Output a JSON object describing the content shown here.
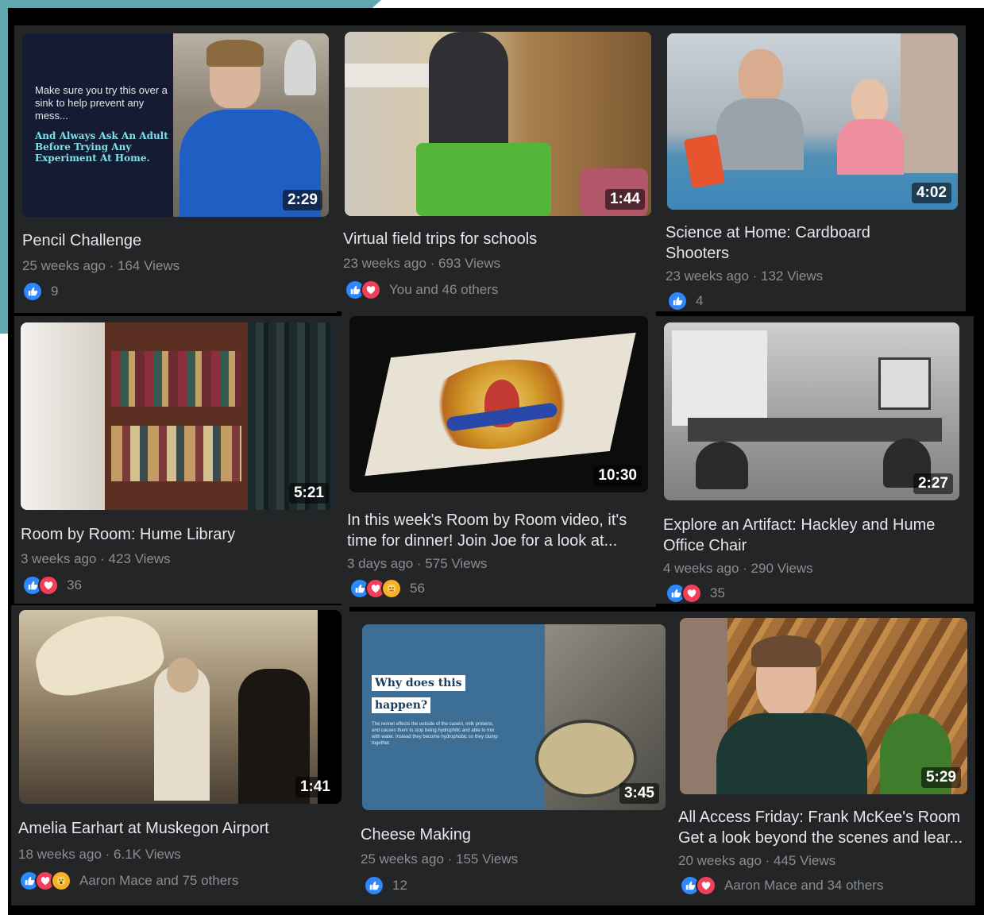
{
  "videos": [
    {
      "title": "Pencil Challenge",
      "meta": "25 weeks ago · 164 Views",
      "duration": "2:29",
      "reactions_text": "9",
      "overlay": {
        "line1": "Make sure you try this over a sink to help prevent any mess...",
        "line2": "And Always Ask An Adult Before Trying Any Experiment At Home."
      }
    },
    {
      "title": "Virtual field trips for schools",
      "meta": "23 weeks ago · 693 Views",
      "duration": "1:44",
      "reactions_text": "You and 46 others"
    },
    {
      "title": "Science at Home: Cardboard Shooters",
      "title_l1": "Science at Home: Cardboard",
      "title_l2": "Shooters",
      "meta": "23 weeks ago · 132 Views",
      "duration": "4:02",
      "reactions_text": "4"
    },
    {
      "title": "Room by Room: Hume Library",
      "meta": "3 weeks ago · 423 Views",
      "duration": "5:21",
      "reactions_text": "36"
    },
    {
      "title_l1": "In this week's Room by Room video, it's",
      "title_l2": "time for dinner! Join Joe for a look at...",
      "meta": "3 days ago · 575 Views",
      "duration": "10:30",
      "reactions_text": "56"
    },
    {
      "title_l1": "Explore an Artifact: Hackley and Hume",
      "title_l2": "Office Chair",
      "meta": "4 weeks ago · 290 Views",
      "duration": "2:27",
      "reactions_text": "35"
    },
    {
      "title": "Amelia Earhart at Muskegon Airport",
      "meta": "18 weeks ago · 6.1K Views",
      "duration": "1:41",
      "reactions_text": "Aaron Mace and 75 others"
    },
    {
      "title": "Cheese Making",
      "meta": "25 weeks ago · 155 Views",
      "duration": "3:45",
      "reactions_text": "12",
      "overlay": {
        "l1": "Why does this",
        "l2": "happen?",
        "body": "The rennet effects the outside of the casein, milk proteins, and causes them to stop being hydrophilic and able to mix with water. Instead they become hydrophobic so they clump together."
      }
    },
    {
      "title_l1": "All Access Friday: Frank McKee's Room",
      "title_l2": "Get a look beyond the scenes and lear...",
      "meta": "20 weeks ago · 445 Views",
      "duration": "5:29",
      "reactions_text": "Aaron Mace and 34 others"
    }
  ],
  "colors": {
    "like": "#2d88ff",
    "love": "#f33e58",
    "care": "#f7b125",
    "panel": "#242526",
    "teal": "#5fa8b0"
  }
}
